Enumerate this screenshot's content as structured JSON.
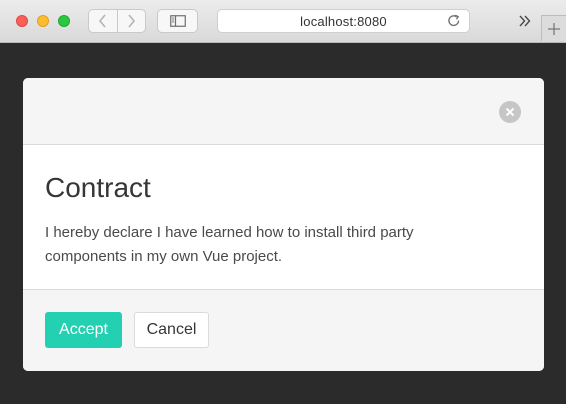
{
  "browser": {
    "address": "localhost:8080",
    "icons": {
      "back": "chevron-left-icon",
      "forward": "chevron-right-icon",
      "sidebar": "sidebar-icon",
      "reload": "reload-icon",
      "overflow": "double-chevron-right-icon",
      "new_tab": "plus-icon"
    }
  },
  "modal": {
    "title": "Contract",
    "body": "I hereby declare I have learned how to install third party components in my own Vue project.",
    "close_icon": "close-icon",
    "accept_label": "Accept",
    "cancel_label": "Cancel"
  },
  "colors": {
    "backdrop": "#2b2b2b",
    "accent": "#23d1b2",
    "modal_header": "#f5f5f5",
    "close_button": "#c6c6c6"
  }
}
